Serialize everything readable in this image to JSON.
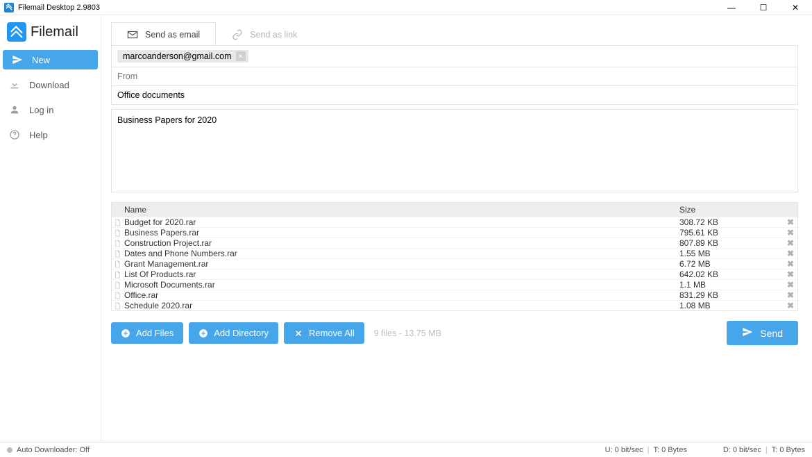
{
  "window": {
    "title": "Filemail Desktop 2.9803"
  },
  "brand": {
    "name": "Filemail"
  },
  "sidebar": {
    "items": [
      {
        "label": "New"
      },
      {
        "label": "Download"
      },
      {
        "label": "Log in"
      },
      {
        "label": "Help"
      }
    ]
  },
  "tabs": {
    "email": "Send as email",
    "link": "Send as link"
  },
  "form": {
    "to": "marcoanderson@gmail.com",
    "from_placeholder": "From",
    "subject": "Office documents",
    "message": "Business Papers for 2020"
  },
  "table": {
    "headers": {
      "name": "Name",
      "size": "Size"
    },
    "rows": [
      {
        "name": "Budget for 2020.rar",
        "size": "308.72 KB"
      },
      {
        "name": "Business Papers.rar",
        "size": "795.61 KB"
      },
      {
        "name": "Construction Project.rar",
        "size": "807.89 KB"
      },
      {
        "name": "Dates and Phone Numbers.rar",
        "size": "1.55 MB"
      },
      {
        "name": "Grant Management.rar",
        "size": "6.72 MB"
      },
      {
        "name": "List Of Products.rar",
        "size": "642.02 KB"
      },
      {
        "name": "Microsoft Documents.rar",
        "size": "1.1 MB"
      },
      {
        "name": "Office.rar",
        "size": "831.29 KB"
      },
      {
        "name": "Schedule 2020.rar",
        "size": "1.08 MB"
      }
    ]
  },
  "actions": {
    "add_files": "Add Files",
    "add_directory": "Add Directory",
    "remove_all": "Remove All",
    "summary": "9 files - 13.75 MB",
    "send": "Send"
  },
  "status": {
    "left": "Auto Downloader: Off",
    "u_rate": "U: 0 bit/sec",
    "u_total": "T: 0 Bytes",
    "d_rate": "D: 0 bit/sec",
    "d_total": "T: 0 Bytes"
  }
}
